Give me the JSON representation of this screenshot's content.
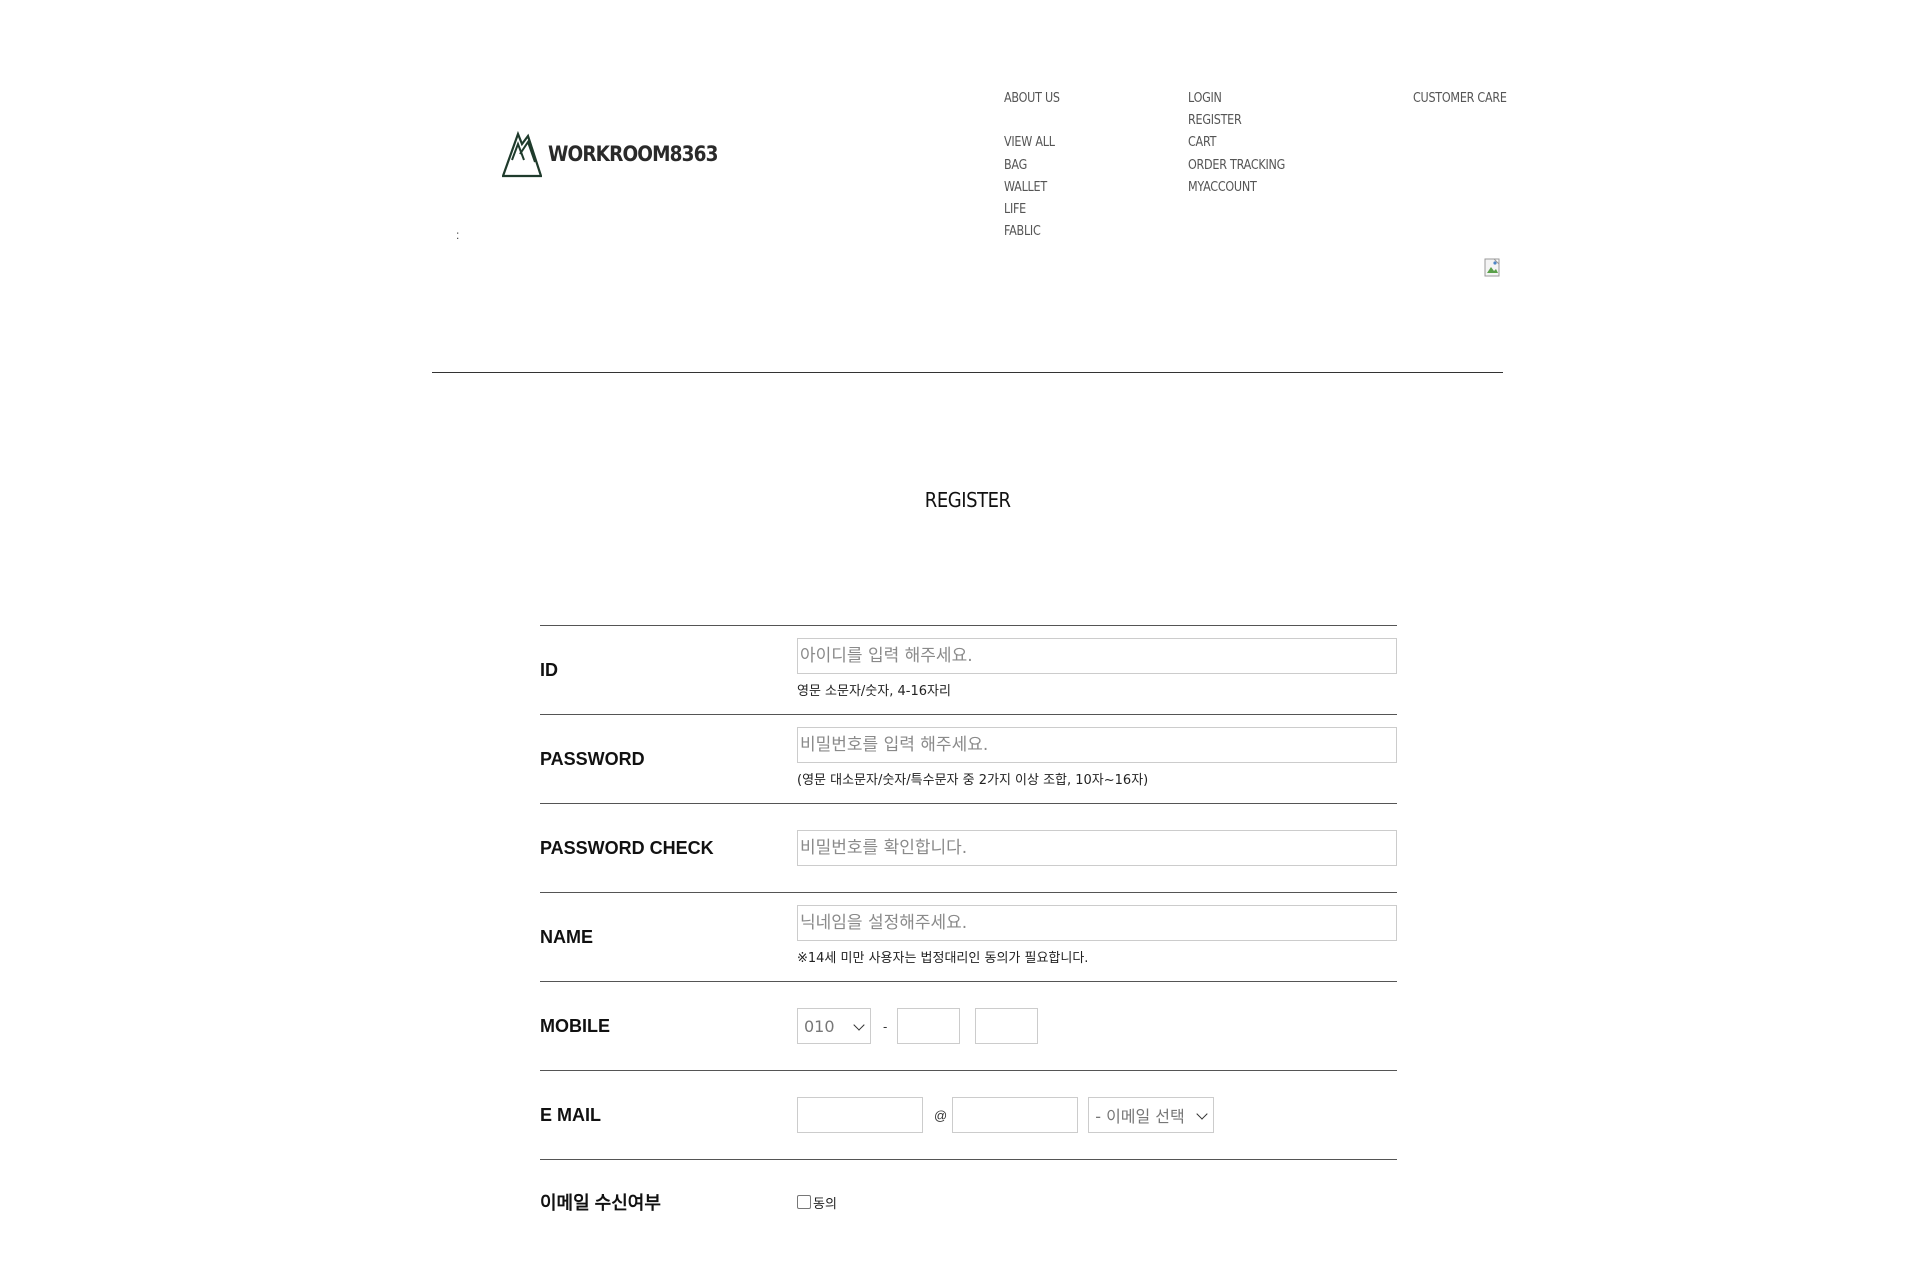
{
  "header": {
    "logo_text": "WORKROOM8363",
    "colon": ":",
    "nav_about": [
      "ABOUT US"
    ],
    "nav_shop": [
      "VIEW ALL",
      "BAG",
      "WALLET",
      "LIFE",
      "FABLIC"
    ],
    "nav_account": [
      "LOGIN",
      "REGISTER",
      "CART",
      "ORDER TRACKING",
      "MYACCOUNT"
    ],
    "nav_care": [
      "CUSTOMER CARE"
    ]
  },
  "page": {
    "title": "REGISTER"
  },
  "form": {
    "id": {
      "label": "ID",
      "placeholder": "아이디를 입력 해주세요.",
      "hint": "영문 소문자/숫자, 4-16자리"
    },
    "password": {
      "label": "PASSWORD",
      "placeholder": "비밀번호를 입력 해주세요.",
      "hint": "(영문 대소문자/숫자/특수문자 중 2가지 이상 조합, 10자~16자)"
    },
    "password_check": {
      "label": "PASSWORD CHECK",
      "placeholder": "비밀번호를 확인합니다."
    },
    "name": {
      "label": "NAME",
      "placeholder": "닉네임을 설정해주세요.",
      "hint": "※14세 미만 사용자는 법정대리인 동의가 필요합니다."
    },
    "mobile": {
      "label": "MOBILE",
      "prefix_selected": "010",
      "separator": "-"
    },
    "email": {
      "label": "E MAIL",
      "at": "@",
      "domain_select": "- 이메일 선택"
    },
    "email_consent": {
      "label": "이메일 수신여부",
      "checkbox_label": "동의",
      "checked": false
    }
  }
}
